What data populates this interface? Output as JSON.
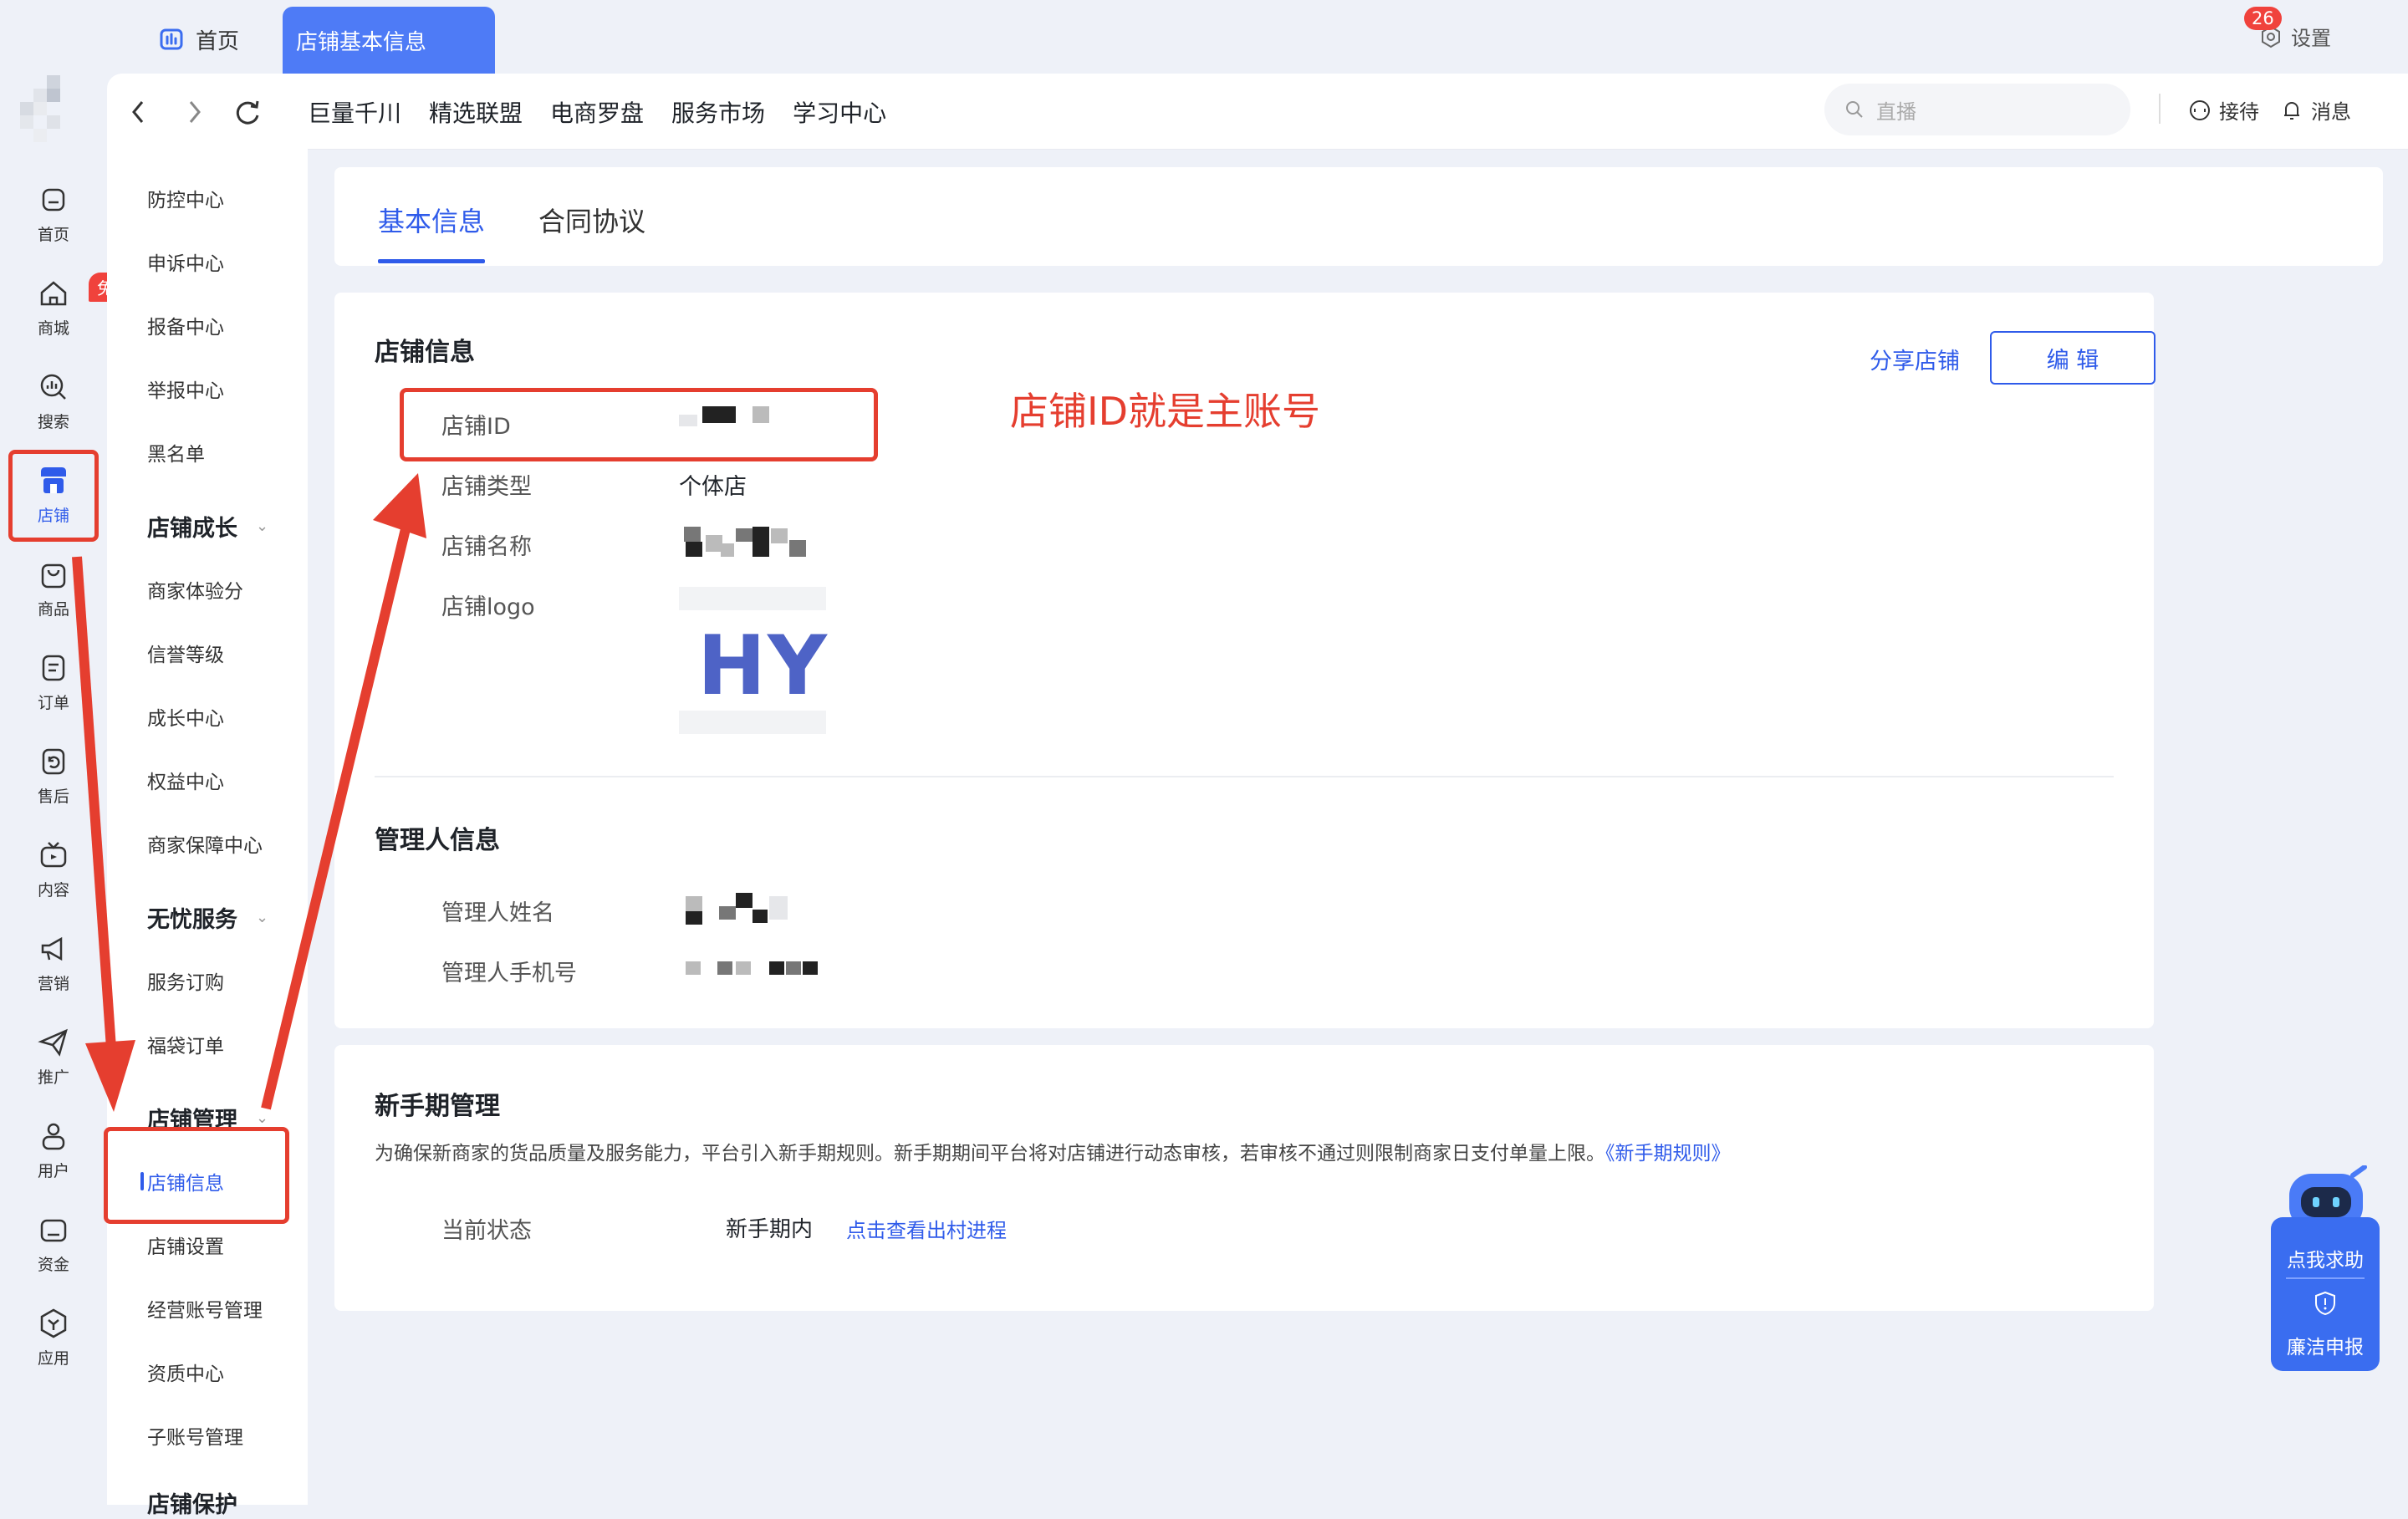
{
  "tabbar": {
    "home_label": "首页",
    "active_tab": "店铺基本信息",
    "settings_label": "设置"
  },
  "rail": {
    "items": [
      {
        "label": "首页",
        "icon": "home-icon"
      },
      {
        "label": "商城",
        "icon": "mall-icon"
      },
      {
        "label": "搜索",
        "icon": "search-analytics-icon"
      },
      {
        "label": "店铺",
        "icon": "store-icon"
      },
      {
        "label": "商品",
        "icon": "bag-icon"
      },
      {
        "label": "订单",
        "icon": "order-icon"
      },
      {
        "label": "售后",
        "icon": "after-sale-icon"
      },
      {
        "label": "内容",
        "icon": "tv-icon"
      },
      {
        "label": "营销",
        "icon": "megaphone-icon"
      },
      {
        "label": "推广",
        "icon": "paper-plane-icon"
      },
      {
        "label": "用户",
        "icon": "user-icon"
      },
      {
        "label": "资金",
        "icon": "wallet-icon"
      },
      {
        "label": "应用",
        "icon": "apps-icon"
      }
    ],
    "free_badge": "免佣",
    "active_index": 3
  },
  "toolbar": {
    "links": [
      "巨量千川",
      "精选联盟",
      "电商罗盘",
      "服务市场",
      "学习中心"
    ],
    "search_placeholder": "直播",
    "reception_label": "接待",
    "messages_label": "消息",
    "messages_count": "26"
  },
  "secnav": {
    "items_top": [
      "防控中心",
      "申诉中心",
      "报备中心",
      "举报中心",
      "黑名单"
    ],
    "group_growth": "店铺成长",
    "items_growth": [
      "商家体验分",
      "信誉等级",
      "成长中心",
      "权益中心",
      "商家保障中心"
    ],
    "group_service": "无忧服务",
    "items_service": [
      "服务订购",
      "福袋订单"
    ],
    "group_manage": "店铺管理",
    "items_manage": [
      "店铺信息",
      "店铺设置",
      "经营账号管理",
      "资质中心",
      "子账号管理"
    ],
    "group_next": "店铺保护"
  },
  "content_tabs": {
    "tabs": [
      "基本信息",
      "合同协议"
    ],
    "active": 0
  },
  "shop_info": {
    "title": "店铺信息",
    "share_label": "分享店铺",
    "edit_label": "编 辑",
    "fields": {
      "id_label": "店铺ID",
      "type_label": "店铺类型",
      "type_value": "个体店",
      "name_label": "店铺名称",
      "logo_label": "店铺logo",
      "logo_text": "HY"
    }
  },
  "manager_info": {
    "title": "管理人信息",
    "name_label": "管理人姓名",
    "phone_label": "管理人手机号"
  },
  "novice": {
    "title": "新手期管理",
    "description": "为确保新商家的货品质量及服务能力，平台引入新手期规则。新手期期间平台将对店铺进行动态审核，若审核不通过则限制商家日支付单量上限。",
    "rule_link": "《新手期规则》",
    "status_label": "当前状态",
    "status_value": "新手期内",
    "progress_link": "点击查看出村进程"
  },
  "annotation": {
    "text": "店铺ID就是主账号",
    "color": "#e53e2f"
  },
  "help_widget": {
    "help_label": "点我求助",
    "report_label": "廉洁申报"
  },
  "colors": {
    "accent": "#2f5bea",
    "active_tab_bg": "#4e7bf6",
    "badge": "#f0423c",
    "annotation": "#e53e2f"
  }
}
